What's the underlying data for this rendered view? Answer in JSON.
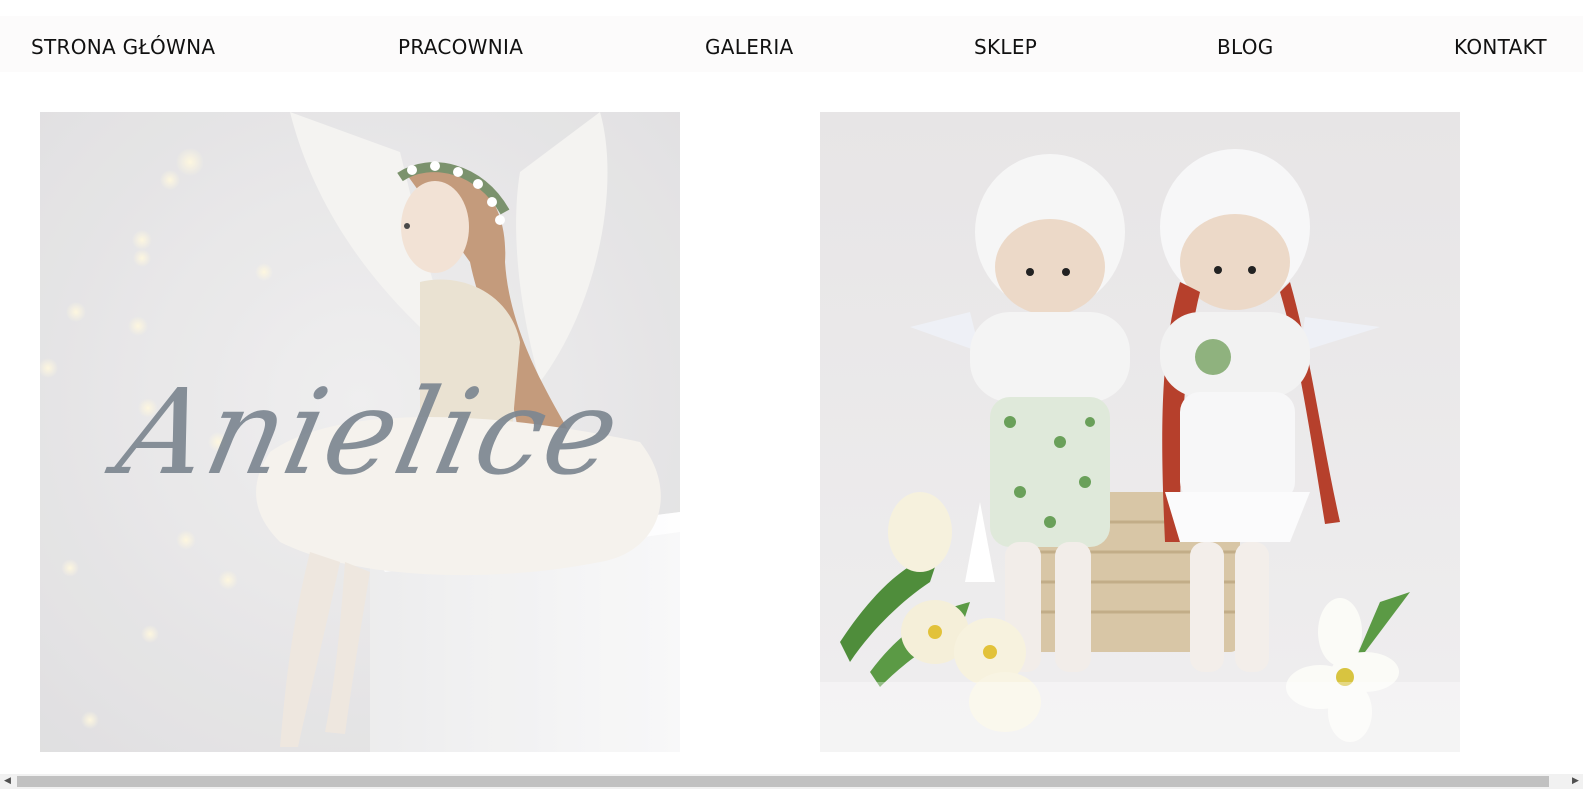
{
  "nav": {
    "items": [
      {
        "label": "STRONA GŁÓWNA"
      },
      {
        "label": "PRACOWNIA"
      },
      {
        "label": "GALERIA"
      },
      {
        "label": "SKLEP"
      },
      {
        "label": "BLOG"
      },
      {
        "label": "KONTAKT"
      }
    ]
  },
  "gallery": {
    "tiles": [
      {
        "title": "Anielice",
        "image": "angel-doll-photo"
      },
      {
        "image": "two-angel-dolls-photo"
      }
    ]
  },
  "scrollbar": {
    "left_arrow": "◀",
    "right_arrow": "▶"
  },
  "colors": {
    "nav_bg": "#fcfbfb",
    "title_script": "#7d8791",
    "scroll_track": "#f1f1f1",
    "scroll_thumb": "#c1c1c1"
  }
}
